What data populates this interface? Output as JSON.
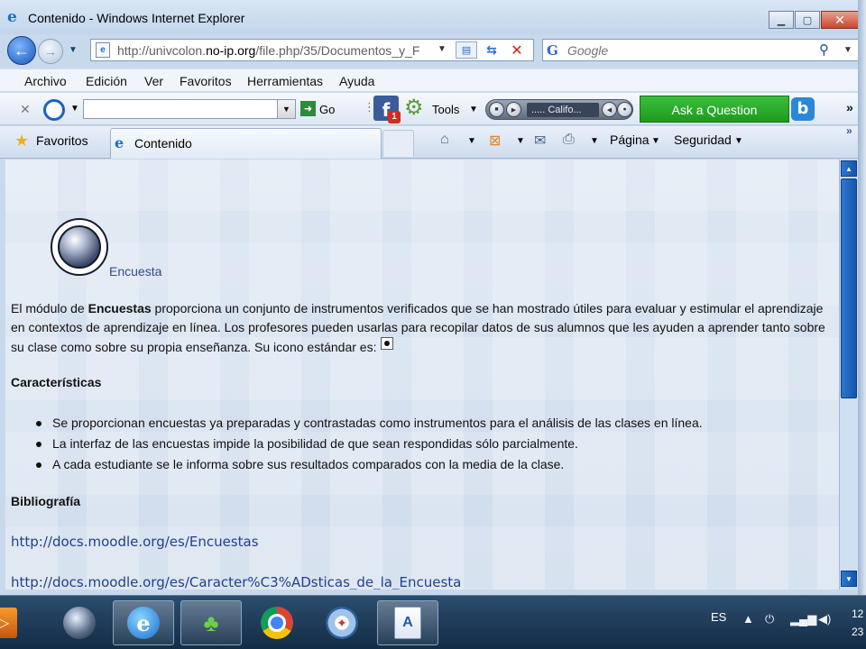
{
  "window": {
    "title": "Contenido - Windows Internet Explorer",
    "minimize": "▁",
    "maximize": "▢",
    "close": "✕"
  },
  "address": {
    "url_prefix": "http://univcolon.",
    "url_host": "no-ip.org",
    "url_suffix": "/file.php/35/Documentos_y_F",
    "search_placeholder": "Google"
  },
  "menu": {
    "items": [
      "Archivo",
      "Edición",
      "Ver",
      "Favoritos",
      "Herramientas",
      "Ayuda"
    ]
  },
  "toolbar": {
    "go_label": "Go",
    "tools_label": "Tools",
    "facebook_badge": "1",
    "radio_station": "..... Califo...",
    "ask_label": "Ask a Question"
  },
  "favorites_bar": {
    "favorites_label": "Favoritos",
    "tab_label": "Contenido",
    "page_label": "Página",
    "security_label": "Seguridad"
  },
  "content": {
    "module_title": "Encuesta",
    "para_1": "El módulo de ",
    "para_bold": "Encuestas",
    "para_2": " proporciona un conjunto de instrumentos verificados que se han mostrado útiles para evaluar y estimular el aprendizaje en contextos de aprendizaje en línea. Los profesores pueden usarlas para recopilar datos de sus alumnos que les ayuden a aprender tanto sobre su clase como sobre su propia enseñanza. Su icono estándar es:",
    "features_heading": "Características",
    "features": [
      "Se proporcionan encuestas ya preparadas y contrastadas como instrumentos para el análisis de las clases en línea.",
      "La interfaz de las encuestas impide la posibilidad de que sean respondidas sólo parcialmente.",
      "A cada estudiante se le informa sobre sus resultados comparados con la media de la clase."
    ],
    "bibliography_heading": "Bibliografía",
    "links": [
      "http://docs.moodle.org/es/Encuestas",
      "http://docs.moodle.org/es/Caracter%C3%ADsticas_de_la_Encuesta"
    ]
  },
  "taskbar": {
    "language": "ES",
    "clock": "12",
    "date": "23"
  }
}
